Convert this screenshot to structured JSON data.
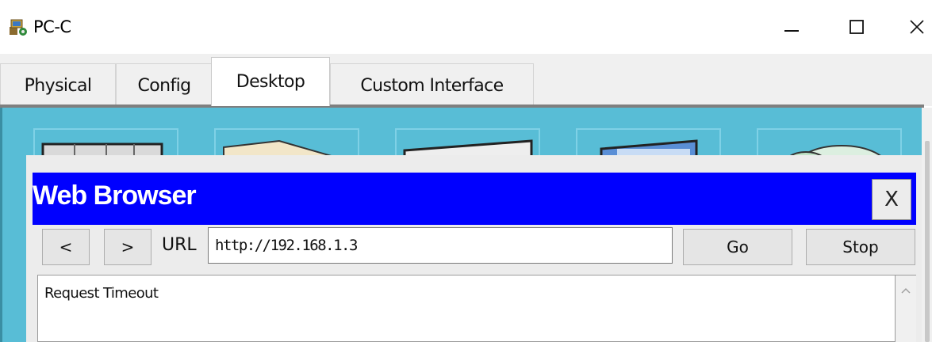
{
  "window": {
    "title": "PC-C",
    "icon": "pc-c-app-icon",
    "minimize_icon": "minimize-icon",
    "maximize_icon": "maximize-icon",
    "close_icon": "close-icon"
  },
  "tabs": [
    {
      "label": "Physical",
      "active": false
    },
    {
      "label": "Config",
      "active": false
    },
    {
      "label": "Desktop",
      "active": true
    },
    {
      "label": "Custom Interface",
      "active": false
    }
  ],
  "browser": {
    "title": "Web Browser",
    "close_label": "X",
    "back_label": "<",
    "forward_label": ">",
    "url_label": "URL",
    "url_value": "http://192.168.1.3",
    "go_label": "Go",
    "stop_label": "Stop",
    "content_text": "Request Timeout",
    "title_bar_color": "#0000ff"
  },
  "colors": {
    "desktop_bg": "#58bdd6"
  }
}
